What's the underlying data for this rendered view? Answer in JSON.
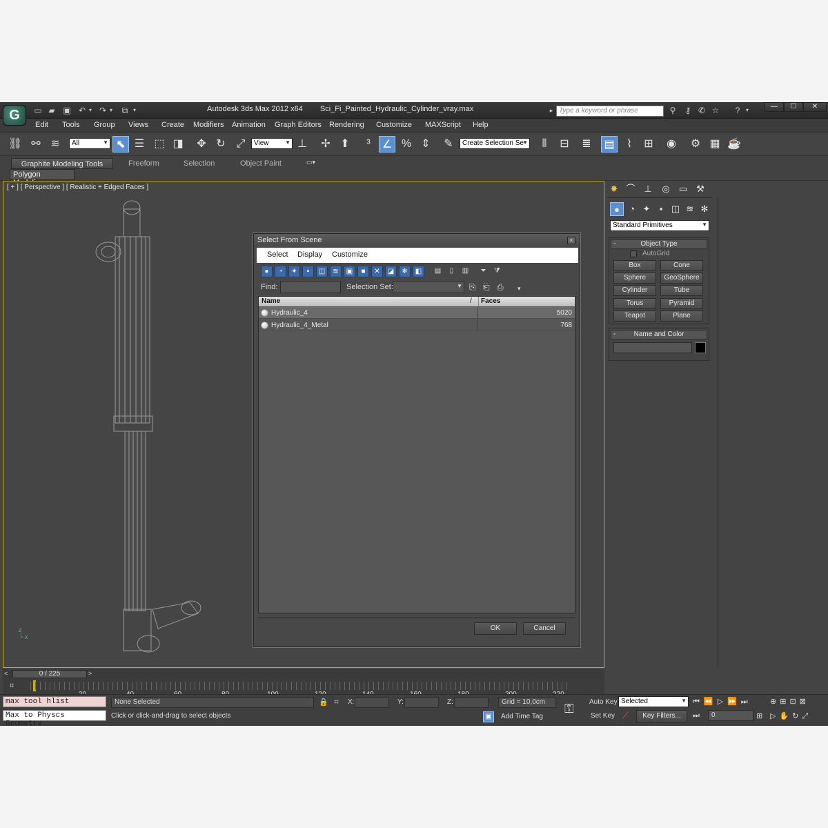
{
  "window": {
    "app_title": "Autodesk 3ds Max  2012 x64",
    "file_name": "Sci_Fi_Painted_Hydraulic_Cylinder_vray.max",
    "search_placeholder": "Type a keyword or phrase",
    "logo_glyph": "G"
  },
  "menu": [
    "Edit",
    "Tools",
    "Group",
    "Views",
    "Create",
    "Modifiers",
    "Animation",
    "Graph Editors",
    "Rendering",
    "Customize",
    "MAXScript",
    "Help"
  ],
  "toolbar": {
    "selection_filter": "All",
    "reference_coord": "View",
    "named_selection": "Create Selection Se"
  },
  "ribbon": {
    "tabs": [
      "Graphite Modeling Tools",
      "Freeform",
      "Selection",
      "Object Paint"
    ],
    "active_panel": "Polygon Modeling"
  },
  "viewport": {
    "label": "[ + ] [ Perspective ] [ Realistic + Edged Faces ]"
  },
  "dialog": {
    "title": "Select From Scene",
    "menu": [
      "Select",
      "Display",
      "Customize"
    ],
    "find_label": "Find:",
    "selection_set_label": "Selection Set:",
    "columns": {
      "name": "Name",
      "faces": "Faces"
    },
    "rows": [
      {
        "name": "Hydraulic_4",
        "faces": "5020"
      },
      {
        "name": "Hydraulic_4_Metal",
        "faces": "768"
      }
    ],
    "ok": "OK",
    "cancel": "Cancel"
  },
  "command_panel": {
    "category": "Standard Primitives",
    "object_type_title": "Object Type",
    "autogrid": "AutoGrid",
    "buttons": [
      "Box",
      "Cone",
      "Sphere",
      "GeoSphere",
      "Cylinder",
      "Tube",
      "Torus",
      "Pyramid",
      "Teapot",
      "Plane"
    ],
    "name_color_title": "Name and Color",
    "object_color": "#000000"
  },
  "timeline": {
    "frame_counter": "0 / 225",
    "ticks": [
      "20",
      "40",
      "60",
      "80",
      "100",
      "120",
      "140",
      "160",
      "180",
      "200",
      "220"
    ]
  },
  "status": {
    "maxscript_line1": "max tool hlist",
    "maxscript_line2": "Max to Physcs Geometry",
    "selection": "None Selected",
    "prompt": "Click or click-and-drag to select objects",
    "x_label": "X:",
    "y_label": "Y:",
    "z_label": "Z:",
    "grid": "Grid = 10,0cm",
    "add_time_tag": "Add Time Tag",
    "auto_key": "Auto Key",
    "set_key": "Set Key",
    "key_mode": "Selected",
    "key_filters": "Key Filters...",
    "current_frame": "0"
  },
  "colors": {
    "viewport_border": "#ccb200",
    "active_button": "#5b8fd0",
    "maxscript_bg": "#f0d4d4"
  }
}
